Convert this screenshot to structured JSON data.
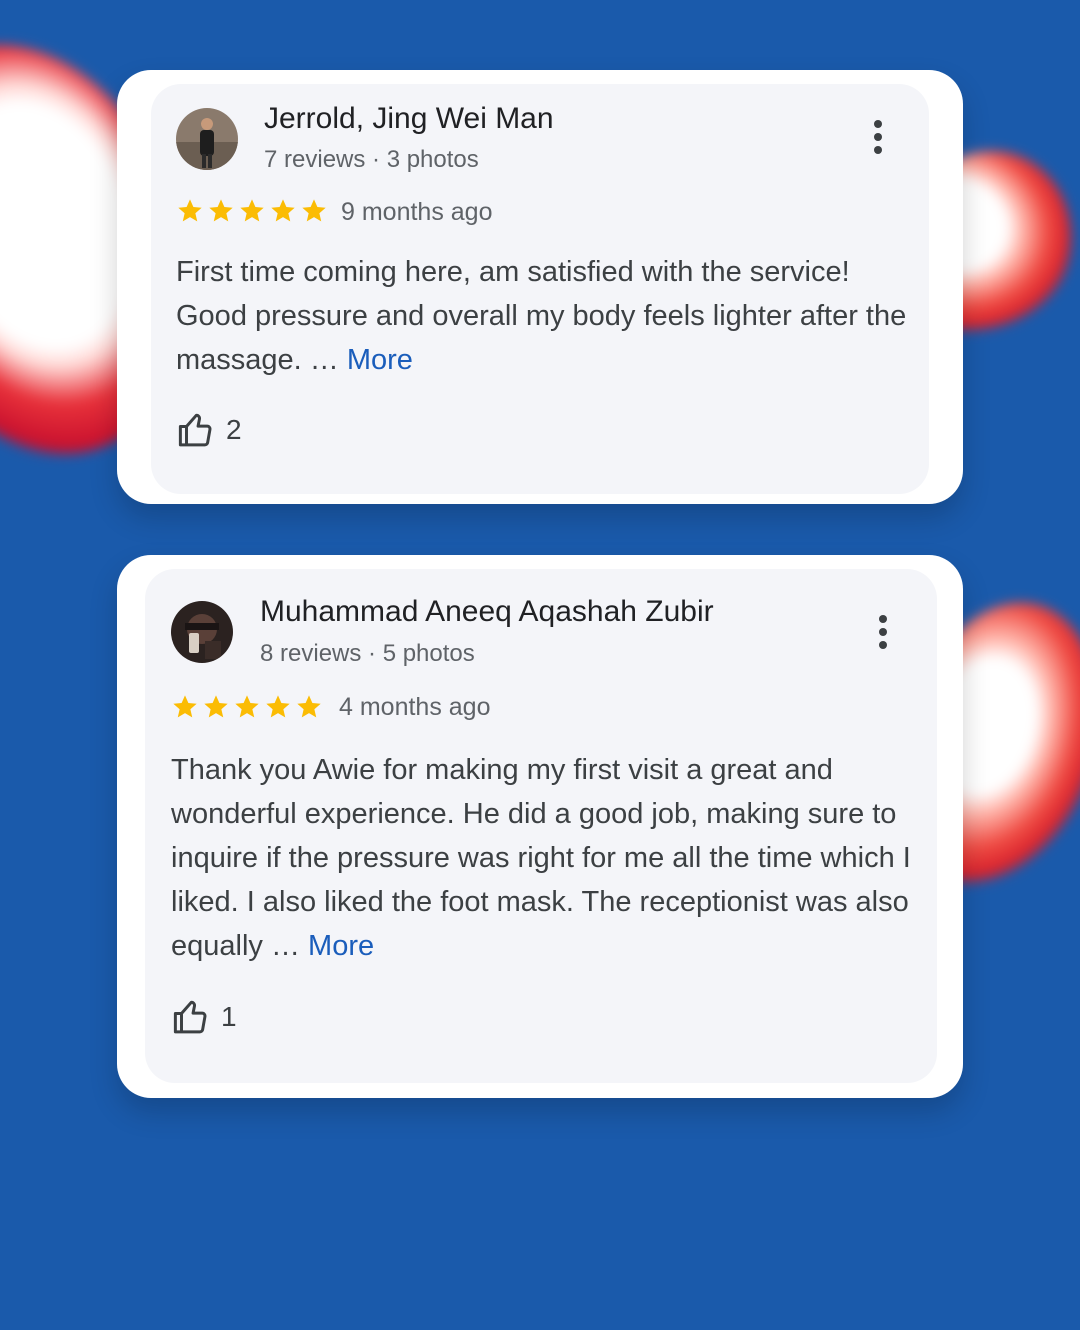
{
  "reviews": [
    {
      "reviewer_name": "Jerrold, Jing Wei Man",
      "reviewer_meta": "7 reviews · 3 photos",
      "rating": 5,
      "time_ago": "9 months ago",
      "text": "First time coming here, am satisfied with the service! Good pressure and overall my body feels lighter after the massage. …",
      "more_label": "More",
      "likes": "2"
    },
    {
      "reviewer_name": "Muhammad Aneeq Aqashah Zubir",
      "reviewer_meta": "8 reviews · 5 photos",
      "rating": 5,
      "time_ago": "4 months ago",
      "text": "Thank you Awie for making my first visit a great and wonderful experience. He did a good job, making sure to inquire if the pressure was right for me all the time which I liked. I also liked the foot mask. The receptionist was also equally …",
      "more_label": "More",
      "likes": "1"
    }
  ],
  "colors": {
    "background": "#1a5aab",
    "star": "#fbbc04",
    "link": "#1a5dbb"
  },
  "icons": [
    "avatar",
    "more-vert-icon",
    "star-icon",
    "thumb-up-icon"
  ]
}
